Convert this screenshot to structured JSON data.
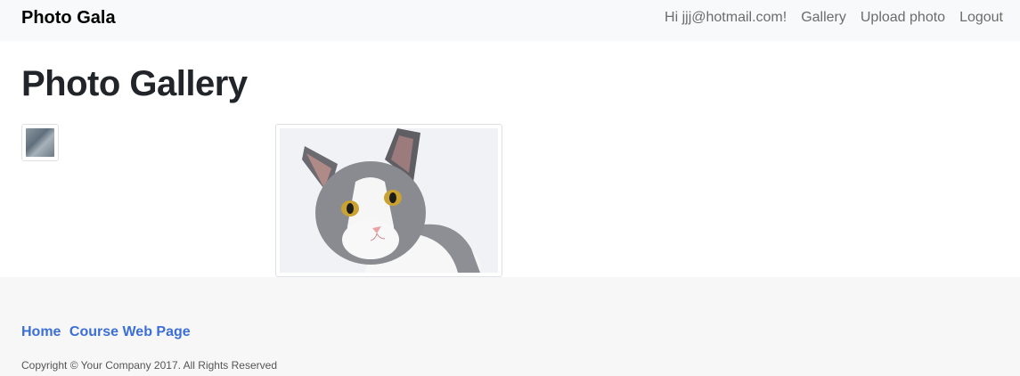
{
  "navbar": {
    "brand": "Photo Gala",
    "greeting": "Hi jjj@hotmail.com!",
    "links": [
      "Gallery",
      "Upload photo",
      "Logout"
    ]
  },
  "main": {
    "title": "Photo Gallery"
  },
  "footer": {
    "links": [
      "Home",
      "Course Web Page"
    ],
    "copyright": "Copyright © Your Company 2017. All Rights Reserved"
  }
}
